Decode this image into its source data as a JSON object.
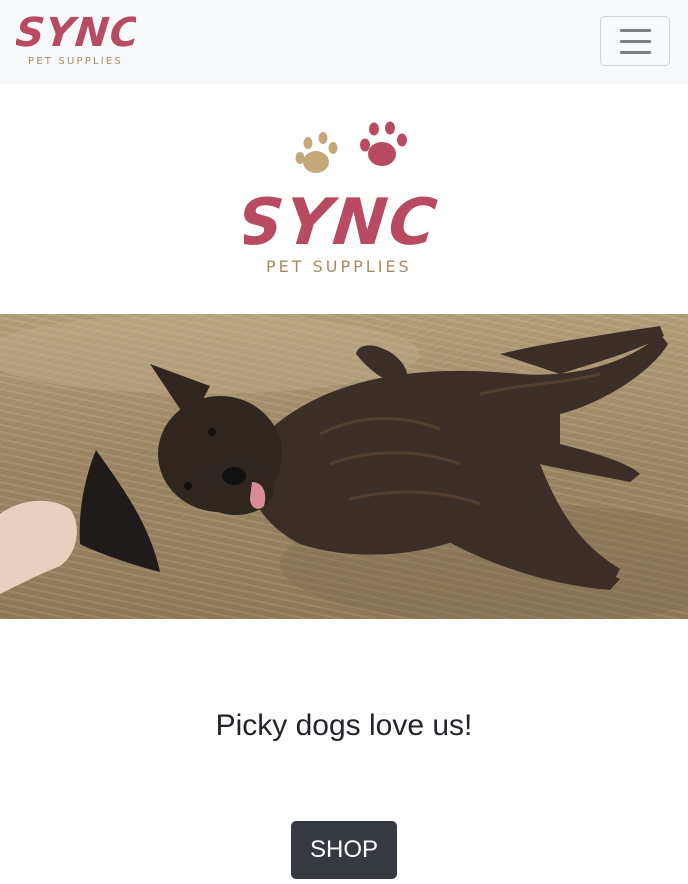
{
  "navbar": {
    "brand_logo": {
      "icon": "sync-pet-supplies-logo",
      "wordmark": "SYNC",
      "tagline": "PET SUPPLIES"
    },
    "toggle_icon": "hamburger-icon"
  },
  "hero": {
    "logo": {
      "icon": "paw-prints-icon",
      "wordmark": "SYNC",
      "tagline": "PET SUPPLIES"
    },
    "photo": {
      "subject": "dog-photo"
    }
  },
  "main": {
    "heading": "Picky dogs love us!",
    "shop_label": "SHOP"
  },
  "colors": {
    "brand_pink": "#b84a62",
    "brand_tan": "#c4a87a",
    "navbar_bg": "#f8f9fa",
    "button_dark": "#343a40"
  }
}
